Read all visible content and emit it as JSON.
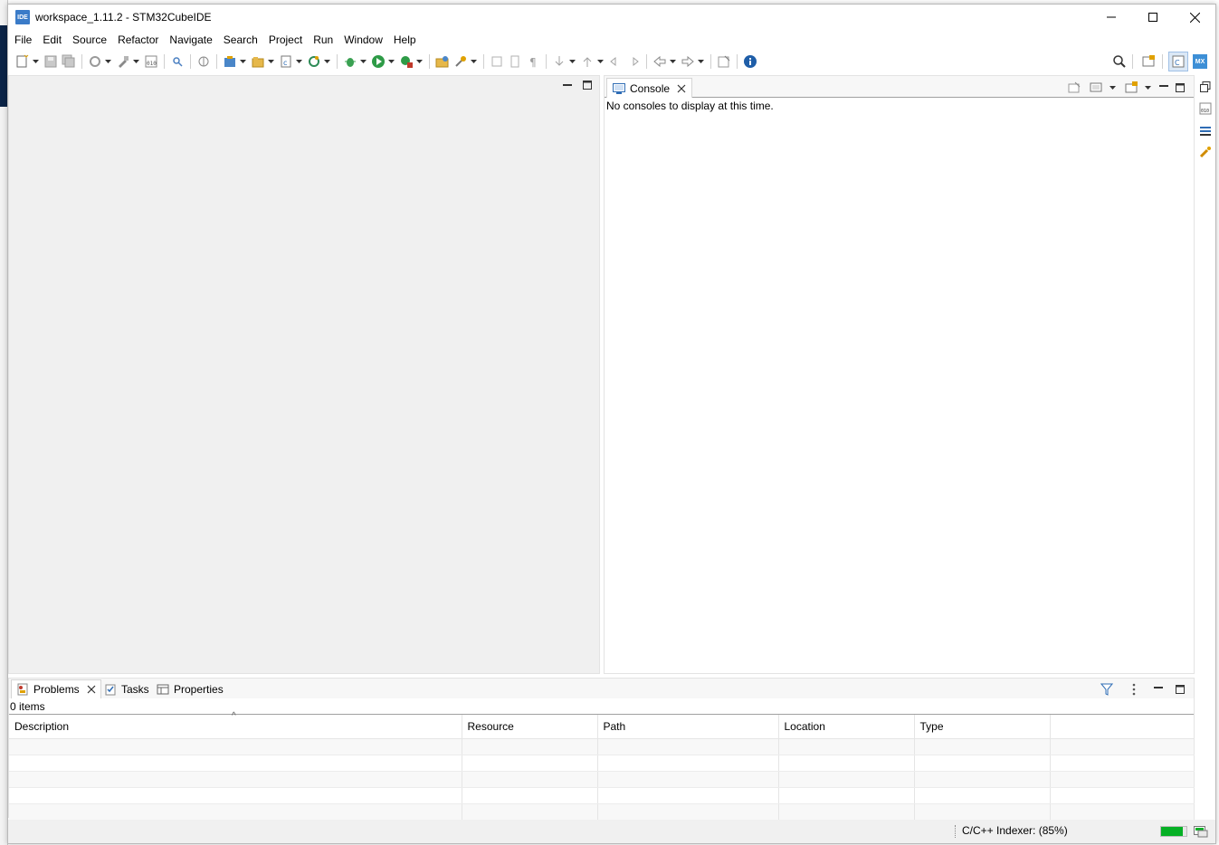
{
  "window": {
    "title": "workspace_1.11.2 - STM32CubeIDE",
    "app_icon_label": "IDE"
  },
  "menu": [
    "File",
    "Edit",
    "Source",
    "Refactor",
    "Navigate",
    "Search",
    "Project",
    "Run",
    "Window",
    "Help"
  ],
  "toolbar": {
    "icons": [
      "new-icon",
      "save-icon",
      "save-all-icon",
      "build-all-icon",
      "build-icon",
      "binary-icon",
      "search-icon",
      "debug-icon",
      "new-project-icon",
      "open-project-icon",
      "new-class-icon",
      "refresh-icon",
      "bug-icon",
      "run-icon",
      "external-tools-icon",
      "open-folder-icon",
      "pin-icon",
      "back-icon",
      "forward-icon",
      "info-icon"
    ],
    "perspective_mx": "MX"
  },
  "console": {
    "tab_label": "Console",
    "message": "No consoles to display at this time."
  },
  "problems": {
    "tabs": [
      "Problems",
      "Tasks",
      "Properties"
    ],
    "count": "0 items",
    "columns": [
      "Description",
      "Resource",
      "Path",
      "Location",
      "Type"
    ],
    "empty_rows": 5
  },
  "status": {
    "indexer": "C/C++ Indexer: (85%)",
    "indexer_progress": 0.85
  },
  "colors": {
    "accent": "#3a7bc8",
    "progress": "#06b025"
  }
}
